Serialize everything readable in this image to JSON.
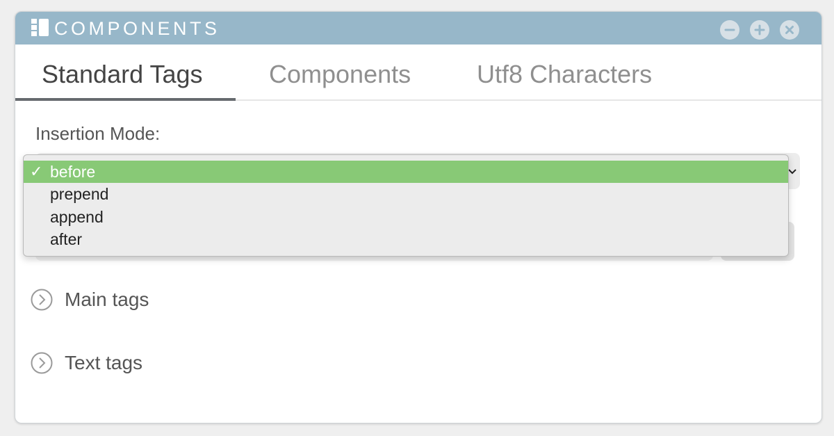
{
  "window": {
    "title": "COMPONENTS",
    "logo_icon": "components-logo-icon",
    "controls": [
      "minimize-icon",
      "maximize-icon",
      "close-icon"
    ],
    "titlebar_color": "#97b7c9"
  },
  "tabs": [
    {
      "label": "Standard Tags",
      "active": true
    },
    {
      "label": "Components",
      "active": false
    },
    {
      "label": "Utf8 Characters",
      "active": false
    }
  ],
  "insertion_mode": {
    "label": "Insertion Mode:",
    "selected": "before",
    "options": [
      {
        "label": "before",
        "checked": true
      },
      {
        "label": "prepend",
        "checked": false
      },
      {
        "label": "append",
        "checked": false
      },
      {
        "label": "after",
        "checked": false
      }
    ],
    "check_mark": "✓",
    "selected_color": "#88c976"
  },
  "sections": [
    {
      "label": "Main tags",
      "icon": "chevron-right-circle-icon"
    },
    {
      "label": "Text tags",
      "icon": "chevron-right-circle-icon"
    }
  ]
}
